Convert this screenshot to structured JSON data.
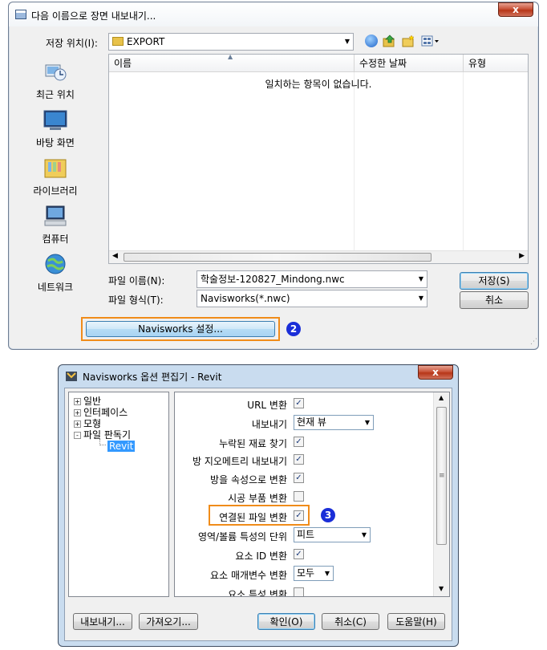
{
  "save_dialog": {
    "title": "다음 이름으로 장면 내보내기...",
    "close_label": "x",
    "location_label": "저장 위치(I):",
    "location_value": "EXPORT",
    "places": [
      {
        "label": "최근 위치",
        "icon": "recent-places-icon"
      },
      {
        "label": "바탕 화면",
        "icon": "desktop-icon"
      },
      {
        "label": "라이브러리",
        "icon": "libraries-icon"
      },
      {
        "label": "컴퓨터",
        "icon": "computer-icon"
      },
      {
        "label": "네트워크",
        "icon": "network-icon"
      }
    ],
    "columns": [
      "이름",
      "수정한 날짜",
      "유형"
    ],
    "empty_message": "일치하는 항목이 없습니다.",
    "filename_label": "파일 이름(N):",
    "filename_value": "학술정보-120827_Mindong.nwc",
    "filetype_label": "파일 형식(T):",
    "filetype_value": "Navisworks(*.nwc)",
    "save_button": "저장(S)",
    "cancel_button": "취소",
    "settings_button": "Navisworks 설정...",
    "callout_2": "2"
  },
  "options_editor": {
    "title": "Navisworks 옵션 편집기 - Revit",
    "close_label": "x",
    "tree": [
      {
        "label": "일반",
        "toggle": "+"
      },
      {
        "label": "인터페이스",
        "toggle": "+"
      },
      {
        "label": "모형",
        "toggle": "+"
      },
      {
        "label": "파일 판독기",
        "toggle": "-"
      },
      {
        "label": "Revit",
        "toggle": ""
      }
    ],
    "options": [
      {
        "label": "URL 변환",
        "type": "check",
        "checked": true
      },
      {
        "label": "내보내기",
        "type": "select",
        "value": "현재 뷰"
      },
      {
        "label": "누락된 재료 찾기",
        "type": "check",
        "checked": true
      },
      {
        "label": "방 지오메트리 내보내기",
        "type": "check",
        "checked": true
      },
      {
        "label": "방을 속성으로 변환",
        "type": "check",
        "checked": true
      },
      {
        "label": "시공 부품 변환",
        "type": "check",
        "checked": false
      },
      {
        "label": "연결된 파일 변환",
        "type": "check",
        "checked": true
      },
      {
        "label": "영역/볼륨 특성의 단위",
        "type": "select",
        "value": "피트"
      },
      {
        "label": "요소 ID 변환",
        "type": "check",
        "checked": true
      },
      {
        "label": "요소 매개변수 변환",
        "type": "select",
        "value": "모두"
      },
      {
        "label": "요소 특성 변환",
        "type": "check",
        "checked": false
      }
    ],
    "check_mark": "✓",
    "callout_3": "3",
    "export_button": "내보내기...",
    "import_button": "가져오기...",
    "ok_button": "확인(O)",
    "cancel_button": "취소(C)",
    "help_button": "도움말(H)"
  },
  "colors": {
    "callout_border": "#f08c1a",
    "callout_circle": "#1a2ed8",
    "tree_selected": "#3399ff"
  }
}
